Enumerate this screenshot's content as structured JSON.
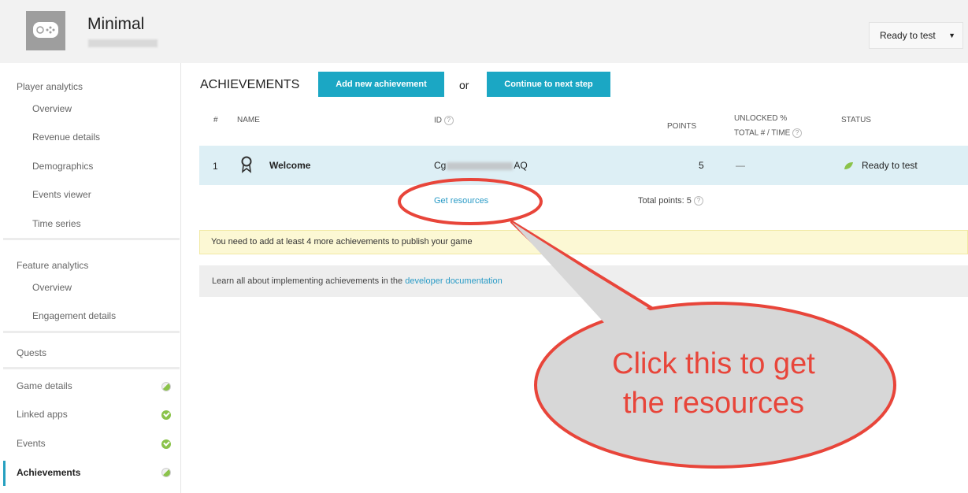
{
  "header": {
    "app_title": "Minimal",
    "app_id": "4411558870011",
    "status_dropdown": "Ready to test",
    "status_caret": "▼"
  },
  "sidebar": {
    "player_analytics": "Player analytics",
    "pa_items": [
      "Overview",
      "Revenue details",
      "Demographics",
      "Events viewer",
      "Time series"
    ],
    "feature_analytics": "Feature analytics",
    "fa_items": [
      "Overview",
      "Engagement details"
    ],
    "quests": "Quests",
    "game_details": "Game details",
    "linked_apps": "Linked apps",
    "events": "Events",
    "achievements": "Achievements"
  },
  "main": {
    "title": "ACHIEVEMENTS",
    "add_button": "Add new achievement",
    "or": "or",
    "continue_button": "Continue to next step",
    "columns": {
      "num": "#",
      "name": "NAME",
      "id": "ID",
      "points": "POINTS",
      "unlocked_1": "UNLOCKED %",
      "unlocked_2": "TOTAL # / TIME",
      "status": "STATUS"
    },
    "row": {
      "num": "1",
      "name": "Welcome",
      "id_prefix": "Cg",
      "id_suffix": "AQ",
      "points": "5",
      "unlocked": "—",
      "status": "Ready to test"
    },
    "get_resources": "Get resources",
    "total_points": "Total points: 5",
    "warning": "You need to add at least 4 more achievements to publish your game",
    "info_prefix": "Learn all about implementing achievements in the ",
    "info_link": "developer documentation"
  },
  "callout": {
    "line1": "Click this to get",
    "line2": "the resources"
  },
  "colors": {
    "accent": "#1ba7c4",
    "callout": "#e8453a",
    "check": "#8bc34a"
  }
}
